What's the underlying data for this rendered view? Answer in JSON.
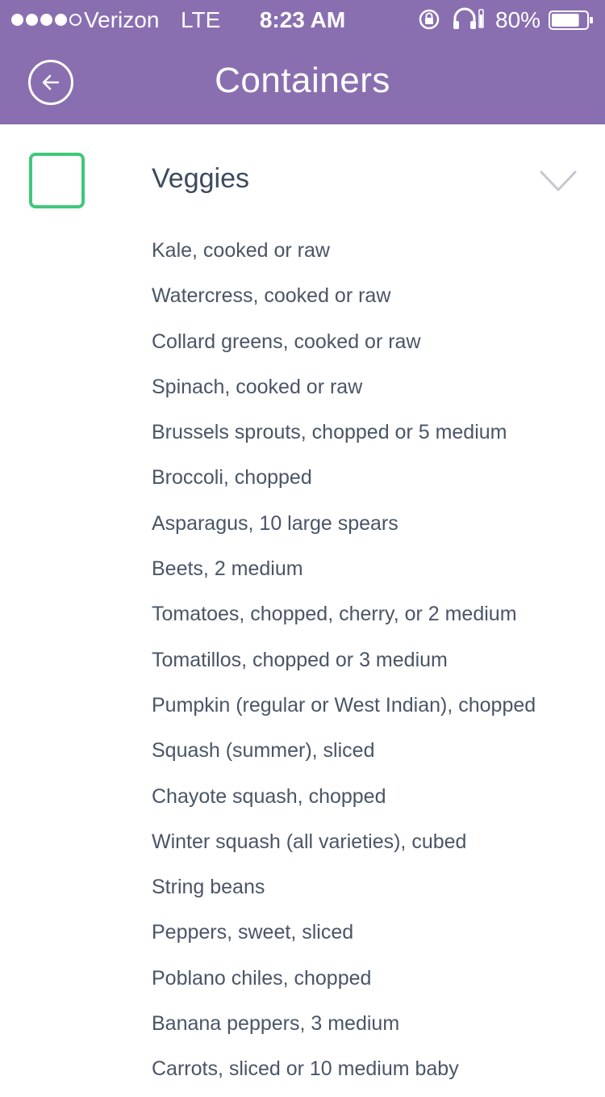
{
  "status_bar": {
    "carrier": "Verizon",
    "network": "LTE",
    "time": "8:23 AM",
    "battery": "80%",
    "battery_level": 0.8
  },
  "header": {
    "title": "Containers"
  },
  "section": {
    "title": "Veggies",
    "checked": false,
    "accent_color": "#3fc87a"
  },
  "items": [
    "Kale, cooked or raw",
    "Watercress, cooked or raw",
    "Collard greens, cooked or raw",
    "Spinach, cooked or raw",
    "Brussels sprouts, chopped or 5 medium",
    "Broccoli, chopped",
    "Asparagus, 10 large spears",
    "Beets, 2 medium",
    "Tomatoes, chopped, cherry, or 2 medium",
    "Tomatillos, chopped or 3 medium",
    "Pumpkin (regular or West Indian), chopped",
    "Squash (summer), sliced",
    "Chayote squash, chopped",
    "Winter squash (all varieties), cubed",
    "String beans",
    "Peppers, sweet, sliced",
    "Poblano chiles, chopped",
    "Banana peppers, 3 medium",
    "Carrots, sliced or 10 medium baby"
  ],
  "colors": {
    "header_bg": "#8a6fb0",
    "text": "#4a5566"
  }
}
